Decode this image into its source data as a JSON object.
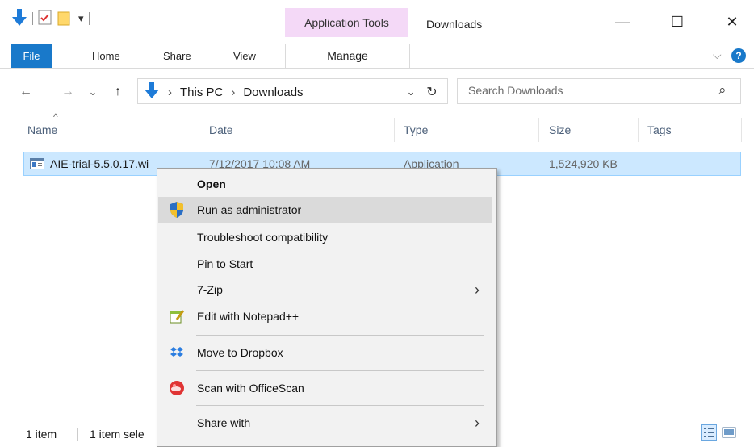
{
  "window": {
    "title": "Downloads",
    "contextual_group": "Application Tools",
    "controls": {
      "minimize": "—",
      "maximize": "☐",
      "close": "✕"
    }
  },
  "quick_access": {
    "dropdown": "▾"
  },
  "ribbon": {
    "tabs": [
      "File",
      "Home",
      "Share",
      "View",
      "Manage"
    ],
    "expand_chevron": "⌵",
    "help": "?"
  },
  "address": {
    "back": "←",
    "forward": "→",
    "recent": "⌄",
    "up": "↑",
    "crumbs": [
      "This PC",
      "Downloads"
    ],
    "crumb_sep": "›",
    "dropdown": "⌄",
    "refresh": "↻",
    "search_placeholder": "Search Downloads",
    "search_icon": "⌕"
  },
  "columns": {
    "sort_indicator": "^",
    "headers": [
      "Name",
      "Date",
      "Type",
      "Size",
      "Tags"
    ]
  },
  "files": [
    {
      "name": "AIE-trial-5.5.0.17.wi",
      "date": "7/12/2017 10:08 AM",
      "type": "Application",
      "size": "1,524,920 KB"
    }
  ],
  "status": {
    "count": "1 item",
    "selected": "1 item sele"
  },
  "context_menu": {
    "items": [
      {
        "label": "Open",
        "bold": true,
        "icon": ""
      },
      {
        "label": "Run as administrator",
        "icon": "uac-shield-icon"
      },
      {
        "label": "Troubleshoot compatibility",
        "icon": ""
      },
      {
        "label": "Pin to Start",
        "icon": ""
      },
      {
        "label": "7-Zip",
        "icon": "",
        "submenu": true
      },
      {
        "label": "Edit with Notepad++",
        "icon": "notepad-icon"
      },
      {
        "label": "Move to Dropbox",
        "icon": "dropbox-icon"
      },
      {
        "label": "Scan with OfficeScan",
        "icon": "officescan-icon"
      },
      {
        "label": "Share with",
        "icon": "",
        "submenu": true
      }
    ],
    "submenu_arrow": "›"
  },
  "colors": {
    "file_tab": "#1979ca",
    "contextual_tab": "#f4d9f7",
    "selection_fill": "#cce8ff",
    "selection_border": "#99d1ff",
    "menu_bg": "#f2f2f2",
    "menu_highlight": "#dadada"
  }
}
